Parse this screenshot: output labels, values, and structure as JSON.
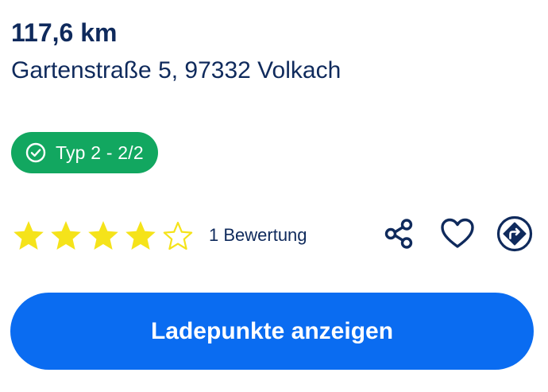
{
  "location": {
    "distance": "117,6 km",
    "address": "Gartenstraße 5, 97332 Volkach"
  },
  "connector_badge": {
    "label": "Typ 2 - 2/2",
    "icon": "check-circle-icon",
    "color": "#12a760"
  },
  "rating": {
    "stars_filled": 4,
    "stars_total": 5,
    "label": "1 Bewertung",
    "star_color": "#f5e31a"
  },
  "actions": {
    "share_icon": "share-icon",
    "favorite_icon": "heart-icon",
    "directions_icon": "directions-icon"
  },
  "cta": {
    "label": "Ladepunkte anzeigen",
    "color": "#0a6cf1"
  },
  "colors": {
    "text_primary": "#0f2a5c"
  }
}
